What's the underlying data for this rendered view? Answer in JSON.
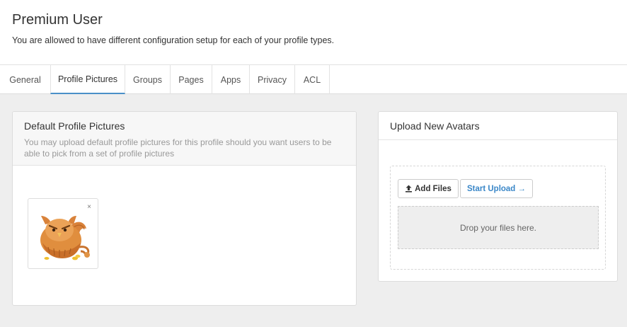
{
  "header": {
    "title": "Premium User",
    "subtitle": "You are allowed to have different configuration setup for each of your profile types."
  },
  "tabs": [
    {
      "label": "General",
      "active": false
    },
    {
      "label": "Profile Pictures",
      "active": true
    },
    {
      "label": "Groups",
      "active": false
    },
    {
      "label": "Pages",
      "active": false
    },
    {
      "label": "Apps",
      "active": false
    },
    {
      "label": "Privacy",
      "active": false
    },
    {
      "label": "ACL",
      "active": false
    }
  ],
  "default_pictures": {
    "title": "Default Profile Pictures",
    "description": "You may upload default profile pictures for this profile should you want users to be able to pick from a set of profile pictures",
    "items": [
      {
        "avatar_icon": "griffin-mascot-icon",
        "remove_label": "×"
      }
    ]
  },
  "upload": {
    "title": "Upload New Avatars",
    "add_files_label": "Add Files",
    "start_upload_label": "Start Upload →",
    "drop_text": "Drop your files here."
  },
  "colors": {
    "accent": "#4a90c8",
    "link": "#3a87c8",
    "background": "#eeeeee"
  }
}
